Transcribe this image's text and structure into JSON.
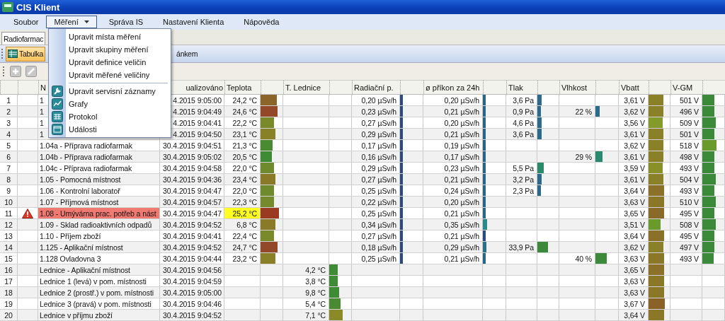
{
  "window": {
    "title": "CIS Klient"
  },
  "menubar": [
    {
      "label": "Soubor",
      "selected": false
    },
    {
      "label": "Měření",
      "selected": true
    },
    {
      "label": "Správa IS",
      "selected": false
    },
    {
      "label": "Nastavení Klienta",
      "selected": false
    },
    {
      "label": "Nápověda",
      "selected": false
    }
  ],
  "menu": {
    "groups": [
      [
        "Upravit místa měření",
        "Upravit skupiny měření",
        "Upravit definice veličin",
        "Upravit měřené veličiny"
      ],
      [
        "Upravit servisní záznamy",
        "Grafy",
        "Protokol",
        "Události"
      ]
    ]
  },
  "tab": {
    "label": "Radiofarmac"
  },
  "view_toolbar": [
    {
      "label": "Tabulka",
      "selected": true
    },
    {
      "label": "ánkem",
      "selected": false
    }
  ],
  "table": {
    "columns": [
      "N",
      "ualizováno",
      "Teplota",
      "T. Lednice",
      "Radiační p.",
      "ø příkon za 24h",
      "Tlak",
      "Vlhkost",
      "Vbatt",
      "V-GM"
    ],
    "rows": [
      {
        "num": "1",
        "alarm": false,
        "name": "1",
        "time": "4.2015 9:05:00",
        "teplota": {
          "text": "24,2 °C",
          "level": 0.75,
          "color": "#8a6428"
        },
        "radiace": {
          "text": "0,20 µSv/h",
          "level": 0.13,
          "color": "#2a4a80"
        },
        "prikon": {
          "text": "0,20 µSv/h",
          "level": 0.13,
          "color": "#2a6488"
        },
        "tlak": {
          "text": "3,6 Pa",
          "level": 0.2,
          "color": "#2a6a8a"
        },
        "vbatt": {
          "text": "3,61 V",
          "level": 0.7,
          "color": "#8a8028"
        },
        "vgm": {
          "text": "501 V",
          "level": 0.55,
          "color": "#3a8a3a"
        }
      },
      {
        "num": "2",
        "alarm": false,
        "name": "1",
        "time": "4.2015 9:04:49",
        "teplota": {
          "text": "24,6 °C",
          "level": 0.78,
          "color": "#94482a"
        },
        "radiace": {
          "text": "0,23 µSv/h",
          "level": 0.13,
          "color": "#2a4a80"
        },
        "prikon": {
          "text": "0,21 µSv/h",
          "level": 0.13,
          "color": "#2a6488"
        },
        "tlak": {
          "text": "0,9 Pa",
          "level": 0.15,
          "color": "#2a6a8a"
        },
        "vlhkost": {
          "text": "22 %",
          "level": 0.2,
          "color": "#2a6a8a"
        },
        "vbatt": {
          "text": "3,62 V",
          "level": 0.7,
          "color": "#8a8028"
        },
        "vgm": {
          "text": "496 V",
          "level": 0.55,
          "color": "#3a8a3a"
        }
      },
      {
        "num": "3",
        "alarm": false,
        "name": "1",
        "time": "4.2015 9:04:41",
        "teplota": {
          "text": "22,2 °C",
          "level": 0.62,
          "color": "#7a8a2a"
        },
        "radiace": {
          "text": "0,27 µSv/h",
          "level": 0.13,
          "color": "#2a4a80"
        },
        "prikon": {
          "text": "0,20 µSv/h",
          "level": 0.13,
          "color": "#2a6488"
        },
        "tlak": {
          "text": "4,6 Pa",
          "level": 0.2,
          "color": "#2a6a8a"
        },
        "vbatt": {
          "text": "3,56 V",
          "level": 0.65,
          "color": "#849a2a"
        },
        "vgm": {
          "text": "509 V",
          "level": 0.6,
          "color": "#3a8a3a"
        }
      },
      {
        "num": "4",
        "alarm": false,
        "name": "1",
        "time": "4.2015 9:04:50",
        "teplota": {
          "text": "23,1 °C",
          "level": 0.69,
          "color": "#8a8028"
        },
        "radiace": {
          "text": "0,29 µSv/h",
          "level": 0.13,
          "color": "#2a4a80"
        },
        "prikon": {
          "text": "0,21 µSv/h",
          "level": 0.13,
          "color": "#2a6488"
        },
        "tlak": {
          "text": "3,6 Pa",
          "level": 0.2,
          "color": "#2a6a8a"
        },
        "vbatt": {
          "text": "3,61 V",
          "level": 0.7,
          "color": "#8a8028"
        },
        "vgm": {
          "text": "501 V",
          "level": 0.55,
          "color": "#3a8a3a"
        }
      },
      {
        "num": "5",
        "alarm": false,
        "name": "1.04a - Příprava radiofarmak",
        "time": "30.4.2015 9:04:51",
        "teplota": {
          "text": "21,3 °C",
          "level": 0.56,
          "color": "#4a8a30"
        },
        "radiace": {
          "text": "0,17 µSv/h",
          "level": 0.13,
          "color": "#2a4a80"
        },
        "prikon": {
          "text": "0,19 µSv/h",
          "level": 0.13,
          "color": "#2a6488"
        },
        "vbatt": {
          "text": "3,62 V",
          "level": 0.7,
          "color": "#8a8028"
        },
        "vgm": {
          "text": "518 V",
          "level": 0.65,
          "color": "#6a9a2a"
        }
      },
      {
        "num": "6",
        "alarm": false,
        "name": "1.04b - Příprava radiofarmak",
        "time": "30.4.2015 9:05:02",
        "teplota": {
          "text": "20,5 °C",
          "level": 0.53,
          "color": "#3f8a35"
        },
        "radiace": {
          "text": "0,16 µSv/h",
          "level": 0.13,
          "color": "#2a4a80"
        },
        "prikon": {
          "text": "0,17 µSv/h",
          "level": 0.13,
          "color": "#2a6488"
        },
        "vlhkost": {
          "text": "29 %",
          "level": 0.3,
          "color": "#2a8a70"
        },
        "vbatt": {
          "text": "3,61 V",
          "level": 0.7,
          "color": "#8a8028"
        },
        "vgm": {
          "text": "498 V",
          "level": 0.55,
          "color": "#3a8a3a"
        }
      },
      {
        "num": "7",
        "alarm": false,
        "name": "1.04c - Příprava radiofarmak",
        "time": "30.4.2015 9:04:58",
        "teplota": {
          "text": "22,0 °C",
          "level": 0.6,
          "color": "#6e8a2c"
        },
        "radiace": {
          "text": "0,29 µSv/h",
          "level": 0.13,
          "color": "#2a4a80"
        },
        "prikon": {
          "text": "0,23 µSv/h",
          "level": 0.13,
          "color": "#2a6488"
        },
        "tlak": {
          "text": "5,5 Pa",
          "level": 0.3,
          "color": "#2a8a6a"
        },
        "vbatt": {
          "text": "3,59 V",
          "level": 0.68,
          "color": "#8a9028"
        },
        "vgm": {
          "text": "493 V",
          "level": 0.55,
          "color": "#3a8a3a"
        }
      },
      {
        "num": "8",
        "alarm": false,
        "name": "1.05 - Pomocná místnost",
        "time": "30.4.2015 9:04:36",
        "teplota": {
          "text": "23,4 °C",
          "level": 0.69,
          "color": "#8a7a28"
        },
        "radiace": {
          "text": "0,27 µSv/h",
          "level": 0.13,
          "color": "#2a4a80"
        },
        "prikon": {
          "text": "0,21 µSv/h",
          "level": 0.13,
          "color": "#2a6488"
        },
        "tlak": {
          "text": "3,2 Pa",
          "level": 0.2,
          "color": "#2a6a8a"
        },
        "vbatt": {
          "text": "3,61 V",
          "level": 0.7,
          "color": "#8a8028"
        },
        "vgm": {
          "text": "504 V",
          "level": 0.6,
          "color": "#3a8a3a"
        }
      },
      {
        "num": "9",
        "alarm": false,
        "name": "1.06 - Kontrolní laboratoř",
        "time": "30.4.2015 9:04:47",
        "teplota": {
          "text": "22,0 °C",
          "level": 0.6,
          "color": "#6e8a2c"
        },
        "radiace": {
          "text": "0,25 µSv/h",
          "level": 0.13,
          "color": "#2a4a80"
        },
        "prikon": {
          "text": "0,24 µSv/h",
          "level": 0.13,
          "color": "#2a6488"
        },
        "tlak": {
          "text": "2,3 Pa",
          "level": 0.18,
          "color": "#2a6a8a"
        },
        "vbatt": {
          "text": "3,64 V",
          "level": 0.72,
          "color": "#8a7028"
        },
        "vgm": {
          "text": "493 V",
          "level": 0.55,
          "color": "#3a8a3a"
        }
      },
      {
        "num": "10",
        "alarm": false,
        "name": "1.07 - Příjmová místnost",
        "time": "30.4.2015 9:04:57",
        "teplota": {
          "text": "22,3 °C",
          "level": 0.62,
          "color": "#748a2c"
        },
        "radiace": {
          "text": "0,22 µSv/h",
          "level": 0.13,
          "color": "#2a4a80"
        },
        "prikon": {
          "text": "0,20 µSv/h",
          "level": 0.13,
          "color": "#2a6488"
        },
        "vbatt": {
          "text": "3,63 V",
          "level": 0.72,
          "color": "#8a7828"
        },
        "vgm": {
          "text": "510 V",
          "level": 0.6,
          "color": "#3a8a3a"
        }
      },
      {
        "num": "11",
        "alarm": true,
        "name": "1.08 - Umývárna prac. potřeb a nást",
        "time": "30.4.2015 9:04:47",
        "teplota": {
          "text": "25,2 °C",
          "level": 0.84,
          "color": "#9a3a22",
          "alert": true
        },
        "radiace": {
          "text": "0,25 µSv/h",
          "level": 0.13,
          "color": "#2a4a80"
        },
        "prikon": {
          "text": "0,21 µSv/h",
          "level": 0.13,
          "color": "#2a6488"
        },
        "vbatt": {
          "text": "3,65 V",
          "level": 0.72,
          "color": "#8a6a28"
        },
        "vgm": {
          "text": "495 V",
          "level": 0.55,
          "color": "#3a8a3a"
        }
      },
      {
        "num": "12",
        "alarm": false,
        "name": "1.09 - Sklad radioaktivních odpadů",
        "time": "30.4.2015 9:04:52",
        "teplota": {
          "text": "6,8 °C",
          "level": 0.69,
          "color": "#8a7a28"
        },
        "radiace": {
          "text": "0,34 µSv/h",
          "level": 0.13,
          "color": "#2a4a80"
        },
        "prikon": {
          "text": "0,35 µSv/h",
          "level": 0.18,
          "color": "#2a8a8a"
        },
        "vbatt": {
          "text": "3,51 V",
          "level": 0.55,
          "color": "#6a9a2a"
        },
        "vgm": {
          "text": "508 V",
          "level": 0.6,
          "color": "#3a8a3a"
        }
      },
      {
        "num": "13",
        "alarm": false,
        "name": "1.10 - Příjem zboží",
        "time": "30.4.2015 9:04:41",
        "teplota": {
          "text": "22,4 °C",
          "level": 0.62,
          "color": "#7a8a2a"
        },
        "radiace": {
          "text": "0,27 µSv/h",
          "level": 0.13,
          "color": "#2a4a80"
        },
        "prikon": {
          "text": "0,21 µSv/h",
          "level": 0.13,
          "color": "#2a4a80"
        },
        "vbatt": {
          "text": "3,64 V",
          "level": 0.72,
          "color": "#8a7028"
        },
        "vgm": {
          "text": "495 V",
          "level": 0.55,
          "color": "#3a8a3a"
        }
      },
      {
        "num": "14",
        "alarm": false,
        "name": "1.125 - Aplikační místnost",
        "time": "30.4.2015 9:04:52",
        "teplota": {
          "text": "24,7 °C",
          "level": 0.78,
          "color": "#94482a"
        },
        "radiace": {
          "text": "0,18 µSv/h",
          "level": 0.13,
          "color": "#2a4a80"
        },
        "prikon": {
          "text": "0,29 µSv/h",
          "level": 0.15,
          "color": "#2a7088"
        },
        "tlak": {
          "text": "33,9 Pa",
          "level": 0.5,
          "color": "#3a8a3a"
        },
        "vbatt": {
          "text": "3,62 V",
          "level": 0.7,
          "color": "#8a8028"
        },
        "vgm": {
          "text": "497 V",
          "level": 0.55,
          "color": "#3a8a3a"
        }
      },
      {
        "num": "15",
        "alarm": false,
        "name": "1.128 Ovladovna 3",
        "time": "30.4.2015 9:04:44",
        "teplota": {
          "text": "23,2 °C",
          "level": 0.69,
          "color": "#8a8028"
        },
        "radiace": {
          "text": "0,25 µSv/h",
          "level": 0.13,
          "color": "#2a4a80"
        },
        "prikon": {
          "text": "0,21 µSv/h",
          "level": 0.13,
          "color": "#2a6488"
        },
        "vlhkost": {
          "text": "40 %",
          "level": 0.5,
          "color": "#3a8a3a"
        },
        "vbatt": {
          "text": "3,63 V",
          "level": 0.72,
          "color": "#8a7828"
        },
        "vgm": {
          "text": "493 V",
          "level": 0.5,
          "color": "#3a8a3a"
        }
      },
      {
        "num": "16",
        "alarm": false,
        "name": "Lednice - Aplikační místnost",
        "time": "30.4.2015 9:04:56",
        "lednice": {
          "text": "4,2 °C",
          "level": 0.4,
          "color": "#3f8a35"
        },
        "vbatt": {
          "text": "3,65 V",
          "level": 0.72,
          "color": "#8a7028"
        }
      },
      {
        "num": "17",
        "alarm": false,
        "name": "Lednice 1 (levá) v pom. místnosti",
        "time": "30.4.2015 9:04:59",
        "lednice": {
          "text": "3,8 °C",
          "level": 0.38,
          "color": "#3f8a35"
        },
        "vbatt": {
          "text": "3,63 V",
          "level": 0.72,
          "color": "#8a7828"
        }
      },
      {
        "num": "18",
        "alarm": false,
        "name": "Lednice 2 (prostř.) v pom. místnosti",
        "time": "30.4.2015 9:05:00",
        "lednice": {
          "text": "9,8 °C",
          "level": 0.45,
          "color": "#3f8a35"
        },
        "vbatt": {
          "text": "3,63 V",
          "level": 0.72,
          "color": "#8a7828"
        }
      },
      {
        "num": "19",
        "alarm": false,
        "name": "Lednice 3 (pravá) v pom. místnosti",
        "time": "30.4.2015 9:04:46",
        "lednice": {
          "text": "5,4 °C",
          "level": 0.5,
          "color": "#4a8a30"
        },
        "vbatt": {
          "text": "3,67 V",
          "level": 0.75,
          "color": "#8a6228"
        }
      },
      {
        "num": "20",
        "alarm": false,
        "name": "Lednice v příjmu zboží",
        "time": "30.4.2015 9:04:52",
        "lednice": {
          "text": "7,1 °C",
          "level": 0.6,
          "color": "#8a8a28"
        },
        "vbatt": {
          "text": "3,64 V",
          "level": 0.72,
          "color": "#8a7828"
        }
      }
    ]
  }
}
